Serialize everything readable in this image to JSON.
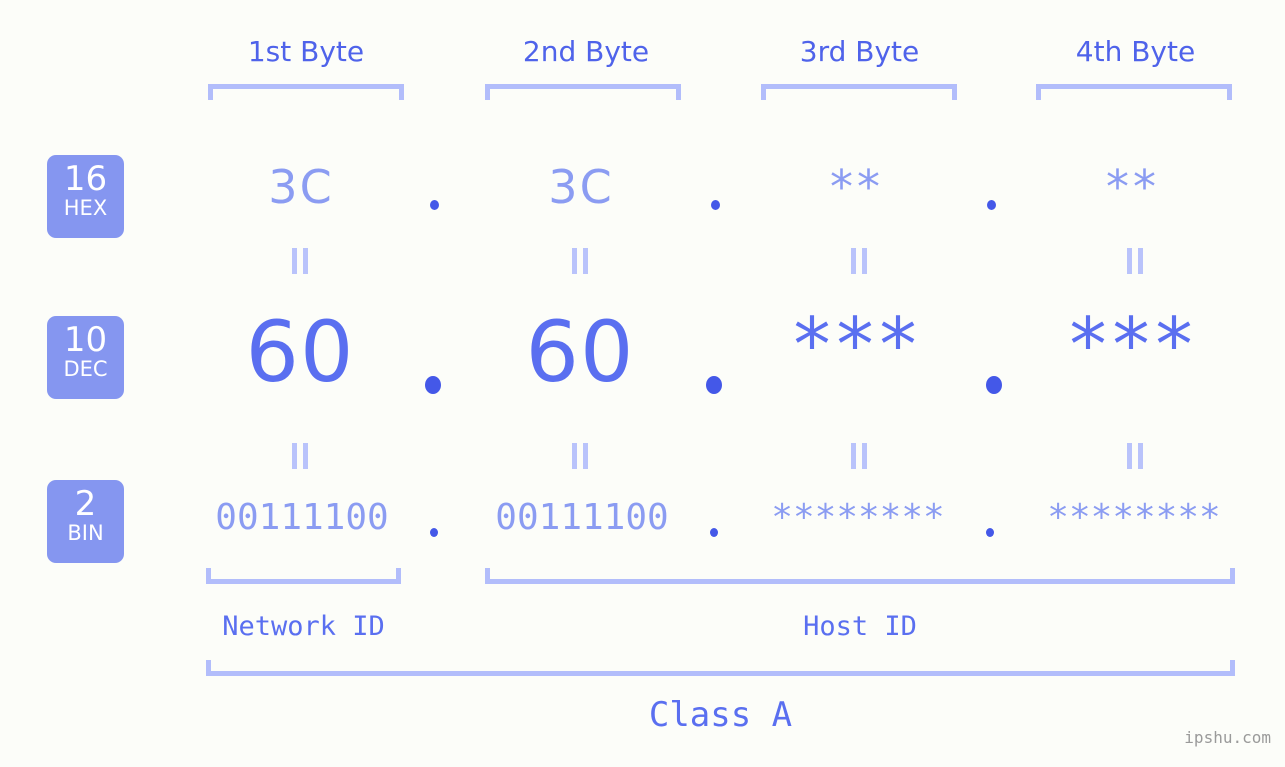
{
  "watermark": "ipshu.com",
  "byte_headers": [
    {
      "label": "1st Byte"
    },
    {
      "label": "2nd Byte"
    },
    {
      "label": "3rd Byte"
    },
    {
      "label": "4th Byte"
    }
  ],
  "bases": [
    {
      "number": "16",
      "name": "HEX"
    },
    {
      "number": "10",
      "name": "DEC"
    },
    {
      "number": "2",
      "name": "BIN"
    }
  ],
  "rows": {
    "hex": {
      "base_number": "16",
      "base_name": "HEX",
      "values": [
        "3C",
        "3C",
        "**",
        "**"
      ],
      "separator": "."
    },
    "dec": {
      "base_number": "10",
      "base_name": "DEC",
      "values": [
        "60",
        "60",
        "***",
        "***"
      ],
      "separator": "."
    },
    "bin": {
      "base_number": "2",
      "base_name": "BIN",
      "values": [
        "00111100",
        "00111100",
        "********",
        "********"
      ],
      "separator": "."
    }
  },
  "connectors": {
    "symbol": "||"
  },
  "segments": {
    "network_id": "Network ID",
    "host_id": "Host ID"
  },
  "class_label": "Class A",
  "colors": {
    "background": "#fcfdf9",
    "header_text": "#4f63ea",
    "bracket": "#b2bdfb",
    "badge_bg": "#8596f0",
    "badge_text": "#ffffff",
    "hex_value": "#8b9cf2",
    "dec_value": "#5a6ff0",
    "bin_value": "#8b9cf2",
    "dot": "#4458e8",
    "connector": "#b9c3fb",
    "watermark": "#9a9a9a"
  }
}
